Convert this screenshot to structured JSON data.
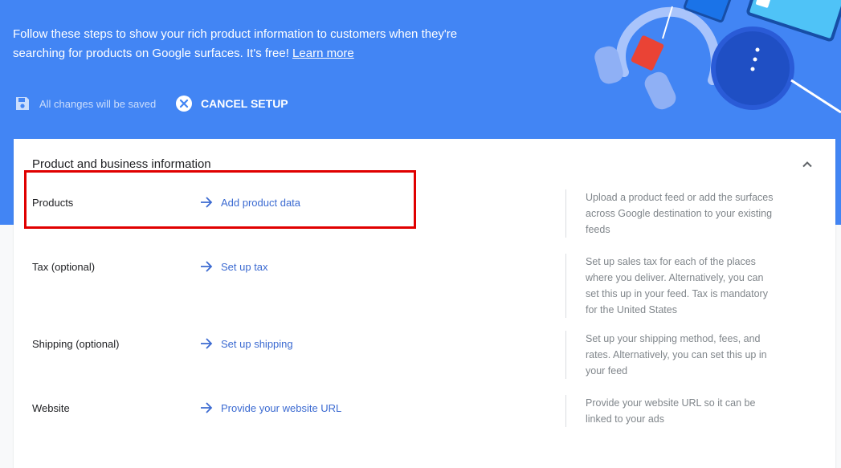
{
  "intro": {
    "text": "Follow these steps to show your rich product information to customers when they're searching for products on Google surfaces. It's free!",
    "learn_more": "Learn more"
  },
  "save_status": {
    "label": "All changes will be saved",
    "icon": "save-icon"
  },
  "cancel_setup": {
    "label": "CANCEL SETUP",
    "icon": "close-circle-icon"
  },
  "card": {
    "title": "Product and business information",
    "collapse_icon": "chevron-up-icon",
    "rows": [
      {
        "label": "Products",
        "action": "Add product data",
        "description": "Upload a product feed or add the surfaces across Google destination to your existing feeds"
      },
      {
        "label": "Tax (optional)",
        "action": "Set up tax",
        "description": "Set up sales tax for each of the places where you deliver. Alternatively, you can set this up in your feed. Tax is mandatory for the United States"
      },
      {
        "label": "Shipping (optional)",
        "action": "Set up shipping",
        "description": "Set up your shipping method, fees, and rates. Alternatively, you can set this up in your feed"
      },
      {
        "label": "Website",
        "action": "Provide your website URL",
        "description": "Provide your website URL so it can be linked to your ads"
      }
    ]
  },
  "colors": {
    "hero": "#4285f4",
    "link": "#3b6ad1",
    "highlight": "#e00000"
  }
}
